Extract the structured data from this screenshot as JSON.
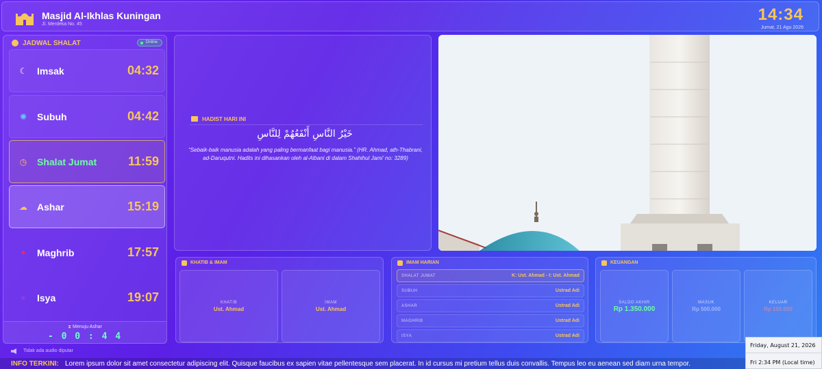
{
  "header": {
    "masjid_name": "Masjid Al-Ikhlas Kuningan",
    "address": "Jl. Merdeka No. 45",
    "clock": "14:34",
    "date": "Jumat, 21 Agu 2026"
  },
  "schedule": {
    "title": "JADWAL SHALAT",
    "status": "Online",
    "prayers": [
      {
        "name": "Imsak",
        "time": "04:32",
        "icon": "moon-icon"
      },
      {
        "name": "Subuh",
        "time": "04:42",
        "icon": "sun-rise-icon"
      },
      {
        "name": "Shalat Jumat",
        "time": "11:59",
        "icon": "clock-icon"
      },
      {
        "name": "Ashar",
        "time": "15:19",
        "icon": "cloud-icon"
      },
      {
        "name": "Maghrib",
        "time": "17:57",
        "icon": "sunset-icon"
      },
      {
        "name": "Isya",
        "time": "19:07",
        "icon": "star-icon"
      }
    ],
    "countdown_label": "Menuju Ashar",
    "countdown": "- 0 0 : 4 4"
  },
  "hadith": {
    "title": "HADIST HARI INI",
    "arabic": "خَيْرُ النَّاسِ أَنْفَعُهُمْ لِلنَّاسِ",
    "text": "“Sebaik-baik manusia adalah yang paling bermanfaat bagi manusia.” (HR. Ahmad, ath-Thabrani, ad-Daruqutni. Hadits ini dihasankan oleh al-Albani di dalam Shahihul Jami’ no: 3289)"
  },
  "khatib_imam": {
    "title": "KHATIB & IMAM",
    "khatib_label": "KHATIB",
    "khatib_value": "Ust. Ahmad",
    "imam_label": "IMAM",
    "imam_value": "Ust. Ahmad"
  },
  "imam_harian": {
    "title": "IMAM HARIAN",
    "rows": [
      {
        "label": "SHALAT JUMAT",
        "value": "K: Ust. Ahmad - I: Ust. Ahmad"
      },
      {
        "label": "SUBUH",
        "value": "Ustrad Adi"
      },
      {
        "label": "ASHAR",
        "value": "Ustrad Adi"
      },
      {
        "label": "MAGHRIB",
        "value": "Ustrad Adi"
      },
      {
        "label": "ISYA",
        "value": "Ustrad Adi"
      }
    ]
  },
  "keuangan": {
    "title": "KEUANGAN",
    "saldo_label": "SALDO AKHIR",
    "saldo_value": "Rp 1.350.000",
    "masuk_label": "MASUK",
    "masuk_value": "Rp 500.000",
    "keluar_label": "KELUAR",
    "keluar_value": "Rp 150.000"
  },
  "audio": {
    "text": "Tidak ada audio diputar"
  },
  "ticker": {
    "label": "INFO TERKINI:",
    "text": "Lorem ipsum dolor sit amet consectetur adipiscing elit. Quisque faucibus ex sapien vitae pellentesque sem placerat. In id cursus mi pretium tellus duis convallis. Tempus leo eu aenean sed diam urna tempor."
  },
  "os_tooltip": {
    "date": "Friday, August 21, 2026",
    "time": "Fri 2:34 PM (Local time)"
  }
}
